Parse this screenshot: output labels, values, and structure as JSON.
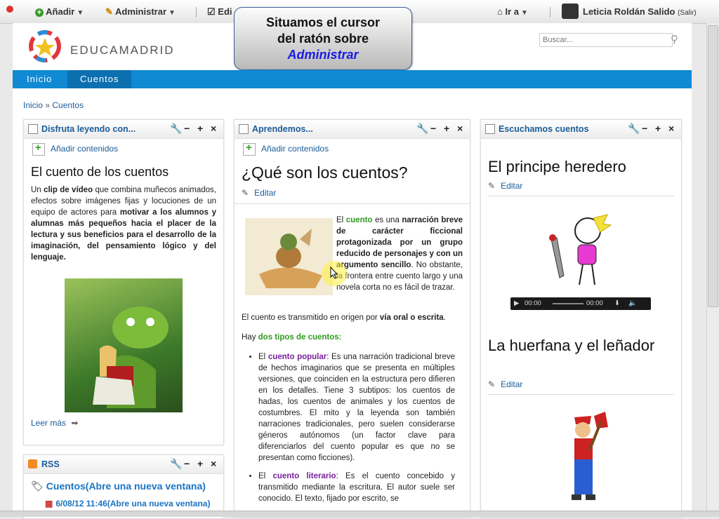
{
  "dockbar": {
    "add_label": "Añadir",
    "manage_label": "Administrar",
    "edit_label": "Edi",
    "goto_label": "Ir a",
    "user_name": "Leticia Roldán Salido",
    "logout_label": "(Salir)"
  },
  "callout": {
    "line1": "Situamos el cursor",
    "line2": "del ratón sobre",
    "line3": "Administrar"
  },
  "header": {
    "logo_text": "EDUCAMADRID",
    "search_placeholder": "Buscar..."
  },
  "nav": {
    "items": [
      "Inicio",
      "Cuentos"
    ]
  },
  "breadcrumb": {
    "item1": "Inicio",
    "separator": "»",
    "item2": "Cuentos"
  },
  "col1": {
    "portlet_title": "Disfruta leyendo con...",
    "add_content": "Añadir contenidos",
    "heading": "El cuento de los cuentos",
    "p_un": "Un",
    "p_clip": "clip de vídeo",
    "p_mid": "que combina muñecos animados, efectos sobre imágenes fijas y locuciones de un equipo de actores para",
    "p_bold": "motivar a los alumnos y alumnas más pequeños hacia el placer de la lectura y sus beneficios para el desarrollo de la imaginación, del pensamiento lógico y del lenguaje.",
    "read_more": "Leer más",
    "rss_title": "RSS",
    "rss_feed": "Cuentos(Abre una nueva ventana)",
    "rss_item": "6/08/12 11:46(Abre una nueva ventana)"
  },
  "col2": {
    "portlet_title": "Aprendemos...",
    "add_content": "Añadir contenidos",
    "heading": "¿Qué son los cuentos?",
    "edit_label": "Editar",
    "p1_el": "El",
    "p1_cuento": "cuento",
    "p1_es": "es una",
    "p1_bold": "narración breve de carácter ficcional protagonizada por un grupo reducido de personajes y con un argumento sencillo",
    "p1_rest": ". No obstante, la frontera entre cuento largo y una novela corta no es fácil de trazar.",
    "p2_pre": "El cuento es transmitido en origen por",
    "p2_bold": "vía oral o escrita",
    "p3_pre": "Hay",
    "p3_green": "dos tipos de cuentos:",
    "li1_el": "El",
    "li1_term": "cuento popular",
    "li1_text": ": Es una narración tradicional breve de hechos imaginarios que se presenta en múltiples versiones, que coinciden en la estructura pero difieren en los detalles. Tiene 3 subtipos: los cuentos de hadas, los cuentos de animales y los cuentos de costumbres. El mito y la leyenda son también narraciones tradicionales, pero suelen considerarse géneros autónomos (un factor clave para diferenciarlos del cuento popular es que no se presentan como ficciones).",
    "li2_el": "El",
    "li2_term": "cuento literario",
    "li2_text": ": Es el cuento concebido y transmitido mediante la escritura. El autor suele ser conocido. El texto, fijado por escrito, se"
  },
  "col3": {
    "portlet_title": "Escuchamos cuentos",
    "heading1": "El principe heredero",
    "edit_label": "Editar",
    "time_current": "00:00",
    "time_total": "00:00",
    "heading2": "La huerfana y el leñador",
    "edit_label2": "Editar"
  },
  "colors": {
    "nav": "#0f8ad3",
    "link": "#1b5c99",
    "green": "#2f9a1f",
    "purple": "#7a1f9a"
  }
}
